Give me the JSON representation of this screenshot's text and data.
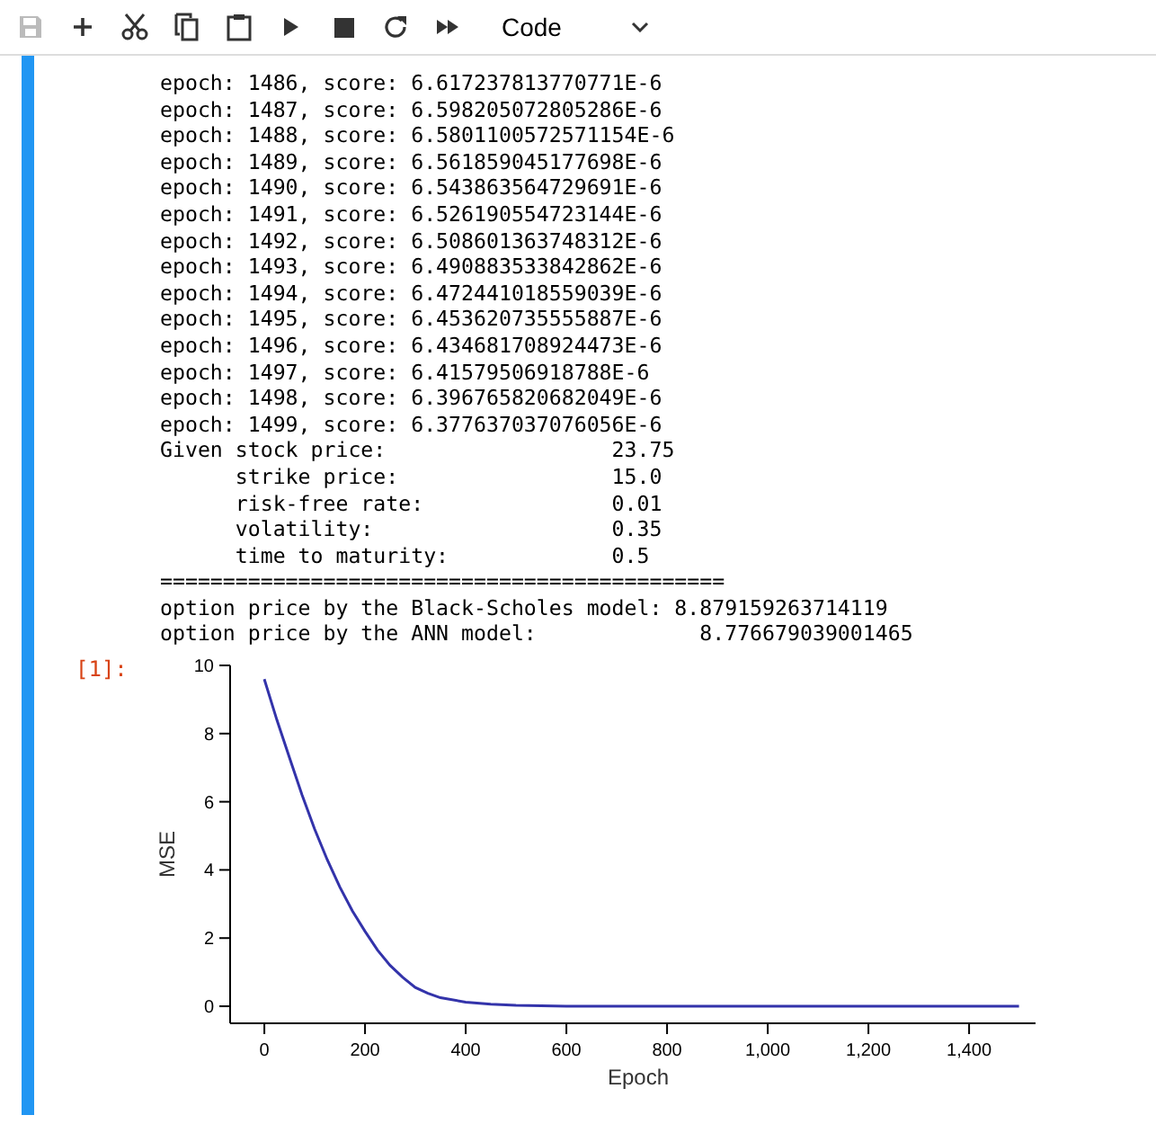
{
  "toolbar": {
    "buttons": [
      {
        "kind": "save",
        "disabled": true
      },
      {
        "kind": "add",
        "disabled": false
      },
      {
        "kind": "cut",
        "disabled": false
      },
      {
        "kind": "copy",
        "disabled": false
      },
      {
        "kind": "paste",
        "disabled": false
      },
      {
        "kind": "run",
        "disabled": false
      },
      {
        "kind": "stop",
        "disabled": false
      },
      {
        "kind": "restart",
        "disabled": false
      },
      {
        "kind": "run-all",
        "disabled": false
      }
    ],
    "cell_type": "Code"
  },
  "output": {
    "lines": [
      "epoch: 1486, score: 6.617237813770771E-6",
      "epoch: 1487, score: 6.598205072805286E-6",
      "epoch: 1488, score: 6.5801100572571154E-6",
      "epoch: 1489, score: 6.561859045177698E-6",
      "epoch: 1490, score: 6.543863564729691E-6",
      "epoch: 1491, score: 6.526190554723144E-6",
      "epoch: 1492, score: 6.508601363748312E-6",
      "epoch: 1493, score: 6.490883533842862E-6",
      "epoch: 1494, score: 6.472441018559039E-6",
      "epoch: 1495, score: 6.453620735555887E-6",
      "epoch: 1496, score: 6.434681708924473E-6",
      "epoch: 1497, score: 6.41579506918788E-6",
      "epoch: 1498, score: 6.396765820682049E-6",
      "epoch: 1499, score: 6.377637037076056E-6",
      "Given stock price:                  23.75",
      "      strike price:                 15.0",
      "      risk-free rate:               0.01",
      "      volatility:                   0.35",
      "      time to maturity:             0.5",
      "=============================================",
      "option price by the Black-Scholes model: 8.879159263714119",
      "option price by the ANN model:             8.776679039001465"
    ]
  },
  "execution_prompt": "[1]:",
  "chart_data": {
    "type": "line",
    "xlabel": "Epoch",
    "ylabel": "MSE",
    "x": [
      0,
      25,
      50,
      75,
      100,
      125,
      150,
      175,
      200,
      225,
      250,
      275,
      300,
      325,
      350,
      400,
      450,
      500,
      600,
      800,
      1000,
      1200,
      1499
    ],
    "series": [
      {
        "color": "#3333aa",
        "values": [
          9.6,
          8.4,
          7.3,
          6.2,
          5.2,
          4.3,
          3.5,
          2.8,
          2.2,
          1.65,
          1.2,
          0.85,
          0.55,
          0.38,
          0.25,
          0.12,
          0.06,
          0.03,
          0.0,
          0.0,
          0.0,
          0.0,
          0.0
        ]
      }
    ],
    "xlim": [
      -68,
      1532
    ],
    "xticks": [
      {
        "value": 0,
        "label": "0"
      },
      {
        "value": 200,
        "label": "200"
      },
      {
        "value": 400,
        "label": "400"
      },
      {
        "value": 600,
        "label": "600"
      },
      {
        "value": 800,
        "label": "800"
      },
      {
        "value": 1000,
        "label": "1,000"
      },
      {
        "value": 1200,
        "label": "1,200"
      },
      {
        "value": 1400,
        "label": "1,400"
      }
    ],
    "yticks": [
      0,
      2,
      4,
      6,
      8,
      10
    ],
    "ylim": [
      -0.5,
      10
    ]
  }
}
